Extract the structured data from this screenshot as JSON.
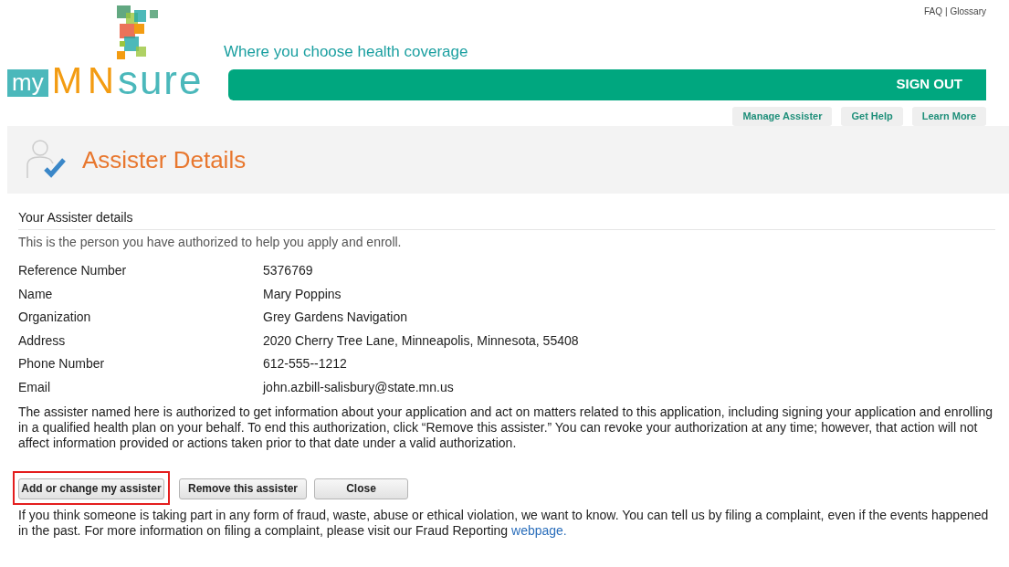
{
  "logo": {
    "prefix": "my",
    "brand_1": "MN",
    "brand_2": "sure"
  },
  "tagline": "Where you choose health coverage",
  "top_links": [
    "FAQ",
    "Glossary"
  ],
  "top_links_separator": "|",
  "sign_out": "SIGN OUT",
  "nav_buttons": [
    "Manage Assister",
    "Get Help",
    "Learn More"
  ],
  "page_title": "Assister Details",
  "section_heading": "Your Assister details",
  "section_intro": "This is the person you have authorized to help you apply and enroll.",
  "details": [
    {
      "label": "Reference Number",
      "value": "5376769"
    },
    {
      "label": "Name",
      "value": "Mary Poppins"
    },
    {
      "label": "Organization",
      "value": "Grey Gardens Navigation"
    },
    {
      "label": "Address",
      "value": "2020 Cherry Tree Lane, Minneapolis, Minnesota, 55408"
    },
    {
      "label": "Phone Number",
      "value": "612-555--1212"
    },
    {
      "label": "Email",
      "value": "john.azbill-salisbury@state.mn.us"
    }
  ],
  "authorization_note": "The assister named here is authorized to get information about your application and act on matters related to this application, including signing your application and enrolling in a qualified health plan on your behalf. To end this authorization, click “Remove this assister.” You can revoke your authorization at any time; however, that action will not affect information provided or actions taken prior to that date under a valid authorization.",
  "buttons": [
    {
      "label": "Add or change my assister",
      "highlighted": true
    },
    {
      "label": "Remove this assister",
      "highlighted": false
    },
    {
      "label": "Close",
      "highlighted": false
    }
  ],
  "fraud_note": "If you think someone is taking part in any form of fraud, waste, abuse or ethical violation, we want to know. You can tell us by filing a complaint, even if the events happened in the past. For more information on filing a complaint, please visit our Fraud Reporting",
  "fraud_link": "webpage."
}
